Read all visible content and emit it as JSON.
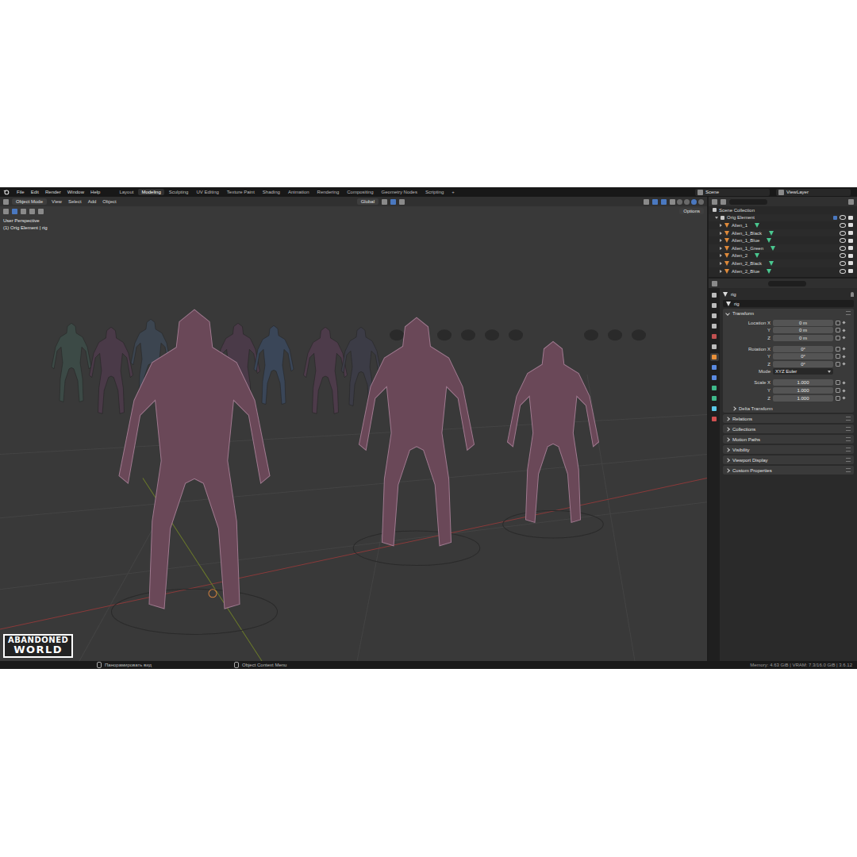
{
  "topbar": {
    "menus": [
      "File",
      "Edit",
      "Render",
      "Window",
      "Help"
    ],
    "workspaces": [
      {
        "label": "Layout",
        "selected": false
      },
      {
        "label": "Modeling",
        "selected": true
      },
      {
        "label": "Sculpting",
        "selected": false
      },
      {
        "label": "UV Editing",
        "selected": false
      },
      {
        "label": "Texture Paint",
        "selected": false
      },
      {
        "label": "Shading",
        "selected": false
      },
      {
        "label": "Animation",
        "selected": false
      },
      {
        "label": "Rendering",
        "selected": false
      },
      {
        "label": "Compositing",
        "selected": false
      },
      {
        "label": "Geometry Nodes",
        "selected": false
      },
      {
        "label": "Scripting",
        "selected": false
      }
    ],
    "add_tab": "+",
    "scene": "Scene",
    "view_layer": "ViewLayer"
  },
  "viewport": {
    "mode": "Object Mode",
    "menus": [
      "View",
      "Select",
      "Add",
      "Object"
    ],
    "orientation": "Global",
    "options": "Options",
    "overlay": [
      "User Perspective",
      "(1) Orig Element | rig"
    ],
    "watermark": [
      "ABANDONED",
      "WORLD"
    ]
  },
  "outliner": {
    "root": "Scene Collection",
    "collection": "Orig Element",
    "items": [
      {
        "name": "Alien_1",
        "visible": true
      },
      {
        "name": "Alien_1_Black",
        "visible": true
      },
      {
        "name": "Alien_1_Blue",
        "visible": true
      },
      {
        "name": "Alien_1_Green",
        "visible": true
      },
      {
        "name": "Alien_2",
        "visible": true
      },
      {
        "name": "Alien_2_Black",
        "visible": true
      },
      {
        "name": "Alien_2_Blue",
        "visible": true
      }
    ]
  },
  "properties": {
    "tabs": [
      {
        "selected": false
      },
      {
        "selected": false
      },
      {
        "selected": false
      },
      {
        "selected": false
      },
      {
        "selected": false
      },
      {
        "selected": false
      },
      {
        "selected": true
      },
      {
        "selected": false
      },
      {
        "selected": false
      },
      {
        "selected": false
      },
      {
        "selected": false
      },
      {
        "selected": false
      },
      {
        "selected": false
      }
    ],
    "object": "rig",
    "name": "rig",
    "section": {
      "label": "Transform",
      "expanded": true
    },
    "groups": [
      {
        "rows": [
          {
            "kind": "field",
            "label": "Location X",
            "value": "0 m"
          },
          {
            "kind": "field",
            "label": "Y",
            "value": "0 m"
          },
          {
            "kind": "field",
            "label": "Z",
            "value": "0 m"
          }
        ]
      },
      {
        "rows": [
          {
            "kind": "field",
            "label": "Rotation X",
            "value": "0°"
          },
          {
            "kind": "field",
            "label": "Y",
            "value": "0°"
          },
          {
            "kind": "field",
            "label": "Z",
            "value": "0°"
          },
          {
            "kind": "dropdown",
            "label": "Mode",
            "value": "XYZ Euler"
          }
        ]
      },
      {
        "rows": [
          {
            "kind": "field",
            "label": "Scale X",
            "value": "1.000"
          },
          {
            "kind": "field",
            "label": "Y",
            "value": "1.000"
          },
          {
            "kind": "field",
            "label": "Z",
            "value": "1.000"
          }
        ]
      }
    ],
    "subpanel": {
      "label": "Delta Transform",
      "expanded": false
    },
    "panels": [
      {
        "label": "Relations",
        "expanded": false
      },
      {
        "label": "Collections",
        "expanded": false
      },
      {
        "label": "Motion Paths",
        "expanded": false
      },
      {
        "label": "Visibility",
        "expanded": false
      },
      {
        "label": "Viewport Display",
        "expanded": false
      },
      {
        "label": "Custom Properties",
        "expanded": false
      }
    ]
  },
  "status_bar": {
    "hints": [
      "Панорамировать вид",
      "Object Context Menu"
    ],
    "info": "Memory: 4.63 GiB | VRAM: 7.3/16.0 GiB | 3.6.12"
  }
}
